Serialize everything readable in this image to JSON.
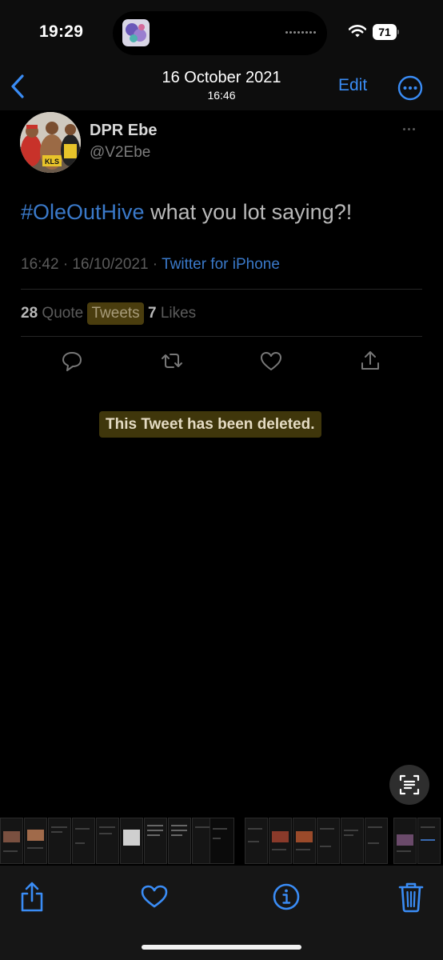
{
  "status_bar": {
    "time": "19:29",
    "battery": "71"
  },
  "nav": {
    "date": "16 October 2021",
    "time": "16:46",
    "edit_label": "Edit"
  },
  "tweet": {
    "display_name": "DPR Ebe",
    "handle": "@V2Ebe",
    "hashtag": "#OleOutHive",
    "text": " what you lot saying?!",
    "timestamp": "16:42 · 16/10/2021 · ",
    "source": "Twitter for iPhone",
    "quote_count": "28",
    "quote_label": "Quote",
    "tweets_label": "Tweets",
    "likes_count": "7",
    "likes_label": "Likes",
    "deleted_notice": "This Tweet has been deleted."
  },
  "colors": {
    "accent": "#3a8cf5",
    "twitter_link": "#3a79c9",
    "highlight": "#3f360b",
    "background": "#000000",
    "toolbar": "#161616"
  },
  "icons": {
    "nav": [
      "back-chevron-icon",
      "more-circle-icon"
    ],
    "tweet_actions": [
      "reply-icon",
      "retweet-icon",
      "like-icon",
      "share-icon"
    ],
    "toolbar": [
      "share-icon",
      "favorite-heart-icon",
      "info-icon",
      "trash-icon"
    ],
    "other": [
      "live-text-icon",
      "wifi-icon",
      "battery-icon"
    ]
  }
}
